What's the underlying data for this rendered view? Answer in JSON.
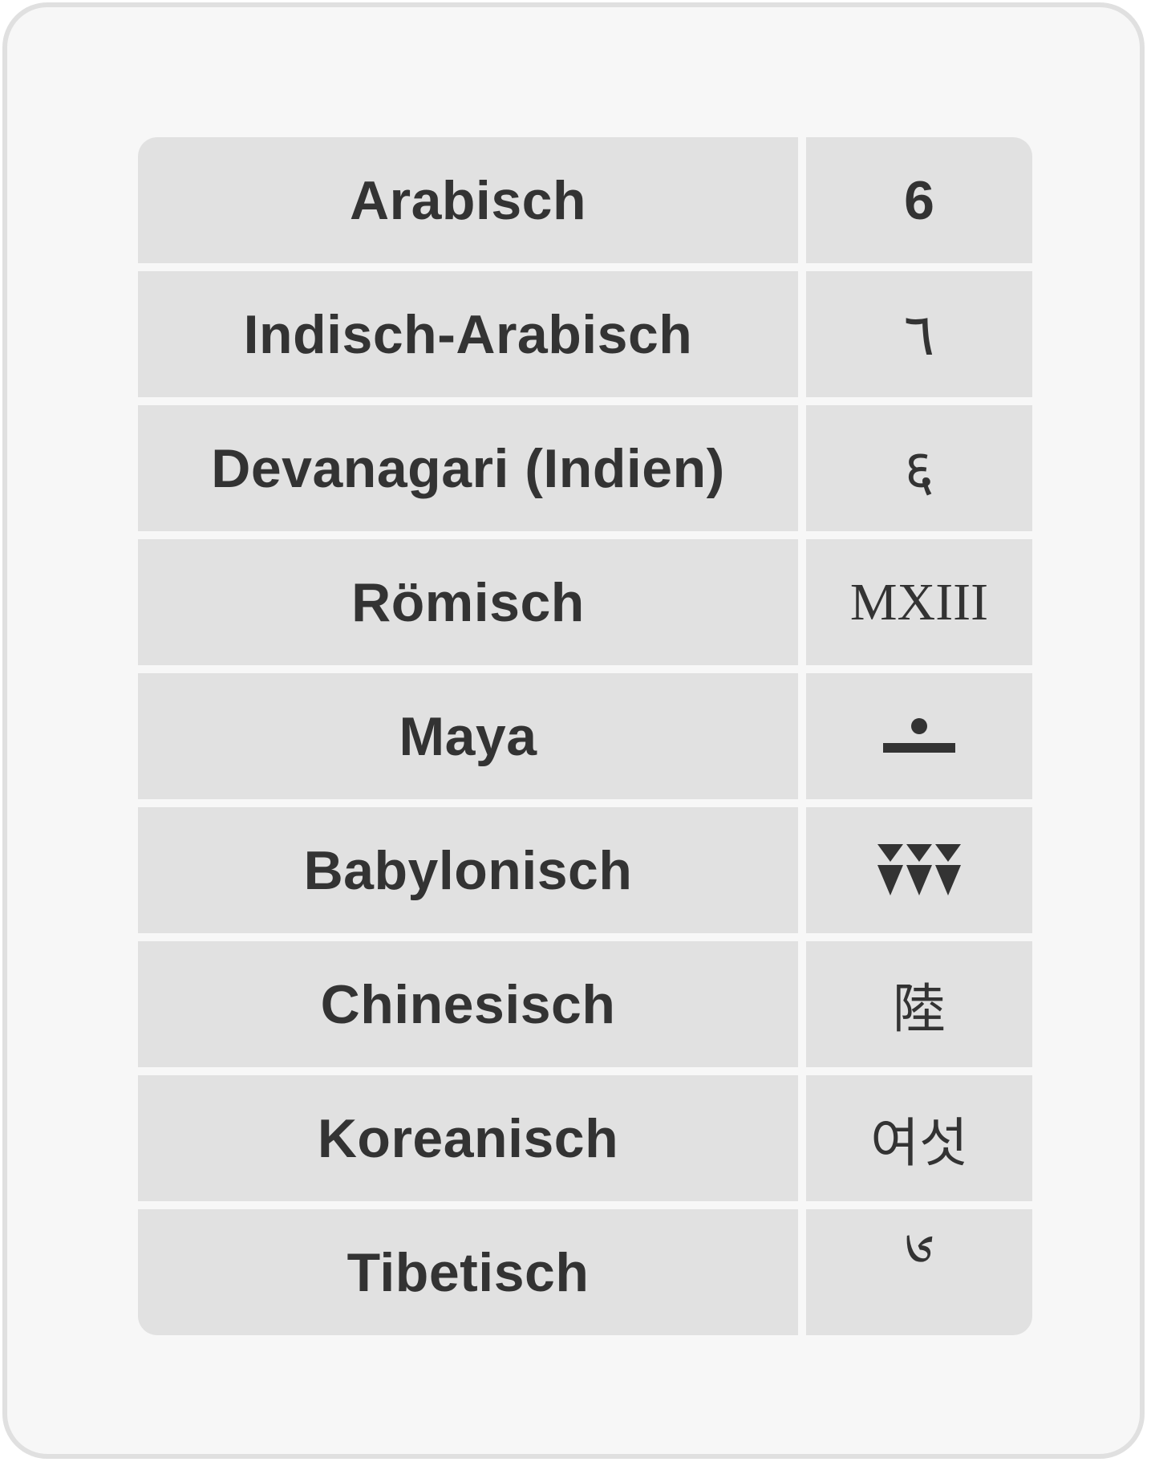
{
  "rows": [
    {
      "name": "Arabisch",
      "numeral": "6"
    },
    {
      "name": "Indisch-Arabisch",
      "numeral": "٦"
    },
    {
      "name": "Devanagari (Indien)",
      "numeral": "६"
    },
    {
      "name": "Römisch",
      "numeral": "MXIII"
    },
    {
      "name": "Maya",
      "numeral": "",
      "numeral_icon": "maya-six-glyph"
    },
    {
      "name": "Babylonisch",
      "numeral": "",
      "numeral_icon": "babylonian-six-wedges-glyph"
    },
    {
      "name": "Chinesisch",
      "numeral": "陸"
    },
    {
      "name": "Koreanisch",
      "numeral": "여섯"
    },
    {
      "name": "Tibetisch",
      "numeral": "༦"
    }
  ],
  "colors": {
    "page_background": "#f7f7f7",
    "frame_border": "#e0e0e0",
    "cell_background": "#e1e1e1",
    "text": "#333333"
  }
}
